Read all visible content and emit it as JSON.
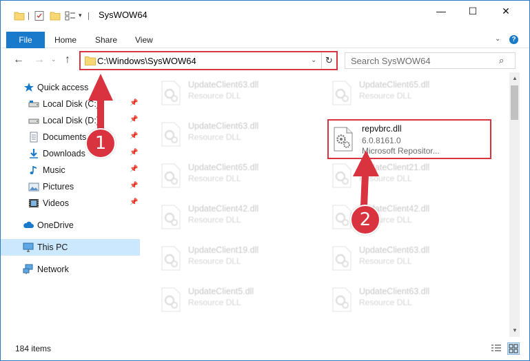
{
  "window": {
    "title": "SysWOW64",
    "buttons": {
      "minimize": "—",
      "maximize": "☐",
      "close": "✕"
    }
  },
  "ribbon": {
    "tabs": [
      "File",
      "Home",
      "Share",
      "View"
    ],
    "help": "?"
  },
  "navigation": {
    "address_path": "C:\\Windows\\SysWOW64",
    "search_placeholder": "Search SysWOW64"
  },
  "sidebar": {
    "items": [
      {
        "label": "Quick access",
        "icon": "star-icon",
        "pinned": false
      },
      {
        "label": "Local Disk (C:)",
        "icon": "drive-icon",
        "pinned": true
      },
      {
        "label": "Local Disk (D:)",
        "icon": "drive-icon",
        "pinned": true
      },
      {
        "label": "Documents",
        "icon": "documents-icon",
        "pinned": true
      },
      {
        "label": "Downloads",
        "icon": "downloads-icon",
        "pinned": true
      },
      {
        "label": "Music",
        "icon": "music-icon",
        "pinned": true
      },
      {
        "label": "Pictures",
        "icon": "pictures-icon",
        "pinned": true
      },
      {
        "label": "Videos",
        "icon": "videos-icon",
        "pinned": true
      },
      {
        "label": "OneDrive",
        "icon": "cloud-icon",
        "pinned": false
      },
      {
        "label": "This PC",
        "icon": "computer-icon",
        "pinned": false,
        "selected": true
      },
      {
        "label": "Network",
        "icon": "network-icon",
        "pinned": false
      }
    ]
  },
  "files": [
    {
      "name": "UpdateClient63.dll",
      "type": "Resource DLL",
      "faded": true
    },
    {
      "name": "UpdateClient65.dll",
      "type": "Resource DLL",
      "faded": true
    },
    {
      "name": "UpdateClient63.dll",
      "type": "Resource DLL",
      "faded": true
    },
    {
      "name": "repvbrc.dll",
      "version": "6.0.8161.0",
      "description": "Microsoft Repositor...",
      "faded": false,
      "highlighted": true
    },
    {
      "name": "UpdateClient65.dll",
      "type": "Resource DLL",
      "faded": true
    },
    {
      "name": "UpdateClient21.dll",
      "type": "Resource DLL",
      "faded": true
    },
    {
      "name": "UpdateClient42.dll",
      "type": "Resource DLL",
      "faded": true
    },
    {
      "name": "UpdateClient42.dll",
      "type": "Resource DLL",
      "faded": true
    },
    {
      "name": "UpdateClient19.dll",
      "type": "Resource DLL",
      "faded": true
    },
    {
      "name": "UpdateClient63.dll",
      "type": "Resource DLL",
      "faded": true
    },
    {
      "name": "UpdateClient5.dll",
      "type": "Resource DLL",
      "faded": true
    },
    {
      "name": "UpdateClient63.dll",
      "type": "Resource DLL",
      "faded": true
    }
  ],
  "status": {
    "item_count": "184 items"
  },
  "annotations": {
    "step1": "1",
    "step2": "2",
    "color": "#d9333f"
  }
}
